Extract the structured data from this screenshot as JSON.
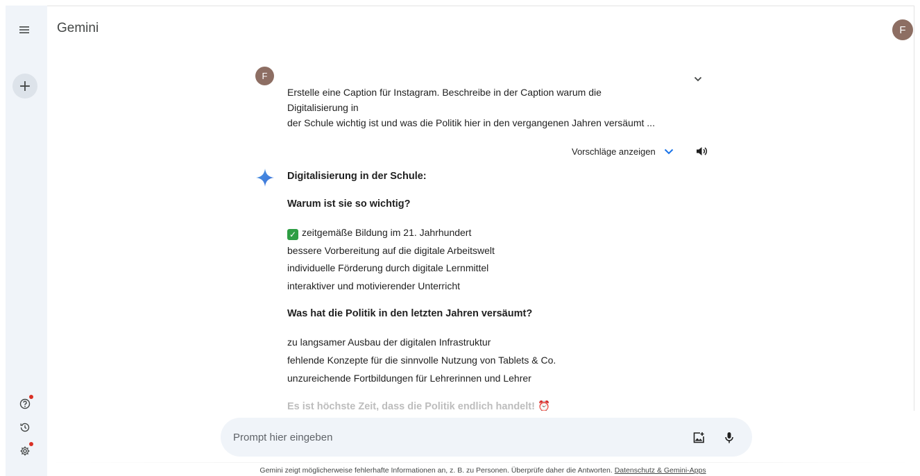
{
  "app": {
    "title": "Gemini",
    "account_initial": "F"
  },
  "sidebar": {
    "new_chat_label": "+",
    "icons": [
      "menu-icon",
      "help-icon",
      "history-icon",
      "settings-icon"
    ]
  },
  "conversation": {
    "user_initial": "F",
    "prompt_lines": [
      "Erstelle eine Caption für Instagram. Beschreibe in der Caption warum die",
      "Digitalisierung in",
      "der Schule wichtig ist und was die Politik hier in den vergangenen Jahren versäumt ..."
    ],
    "suggestions_label": "Vorschläge anzeigen",
    "response": {
      "heading1": "Digitalisierung in der Schule:",
      "heading2": "Warum ist sie so wichtig?",
      "reasons": [
        "zeitgemäße Bildung im 21. Jahrhundert",
        "bessere Vorbereitung auf die digitale Arbeitswelt",
        "individuelle Förderung durch digitale Lernmittel",
        "interaktiver und motivierender Unterricht"
      ],
      "check_mark": "✓",
      "heading3": "Was hat die Politik in den letzten Jahren versäumt?",
      "failures": [
        "zu langsamer Ausbau der digitalen Infrastruktur",
        "fehlende Konzepte für die sinnvolle Nutzung von Tablets & Co.",
        "unzureichende Fortbildungen für Lehrerinnen und Lehrer"
      ],
      "closing": "Es ist höchste Zeit, dass die Politik endlich handelt! ⏰"
    }
  },
  "input": {
    "placeholder": "Prompt hier eingeben"
  },
  "footer": {
    "disclaimer": "Gemini zeigt möglicherweise fehlerhafte Informationen an, z. B. zu Personen. Überprüfe daher die Antworten.",
    "link": "Datenschutz & Gemini-Apps"
  },
  "colors": {
    "sidebar_bg": "#f0f4f9",
    "avatar_bg": "#8d6e63",
    "accent_blue": "#1a73e8",
    "notification_red": "#d93025"
  }
}
